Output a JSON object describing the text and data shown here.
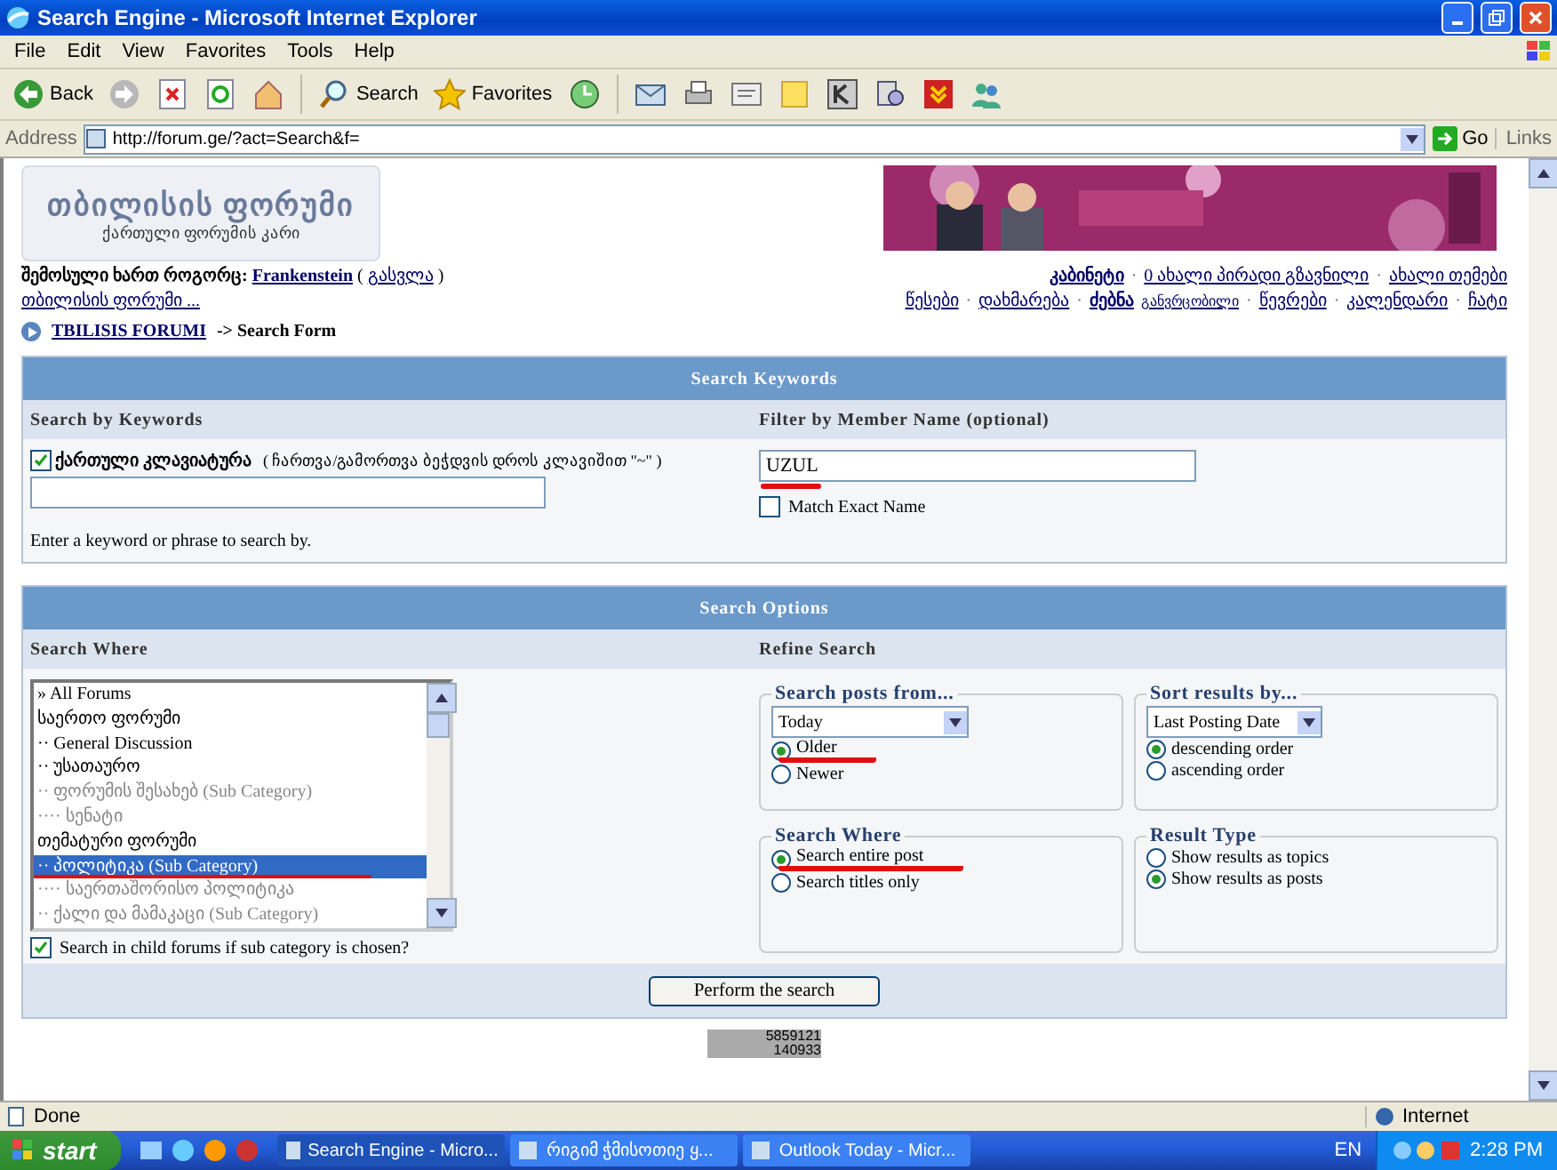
{
  "window": {
    "title": "Search Engine - Microsoft Internet Explorer"
  },
  "menu": [
    "File",
    "Edit",
    "View",
    "Favorites",
    "Tools",
    "Help"
  ],
  "toolbar": [
    {
      "kind": "back",
      "label": "Back"
    },
    {
      "kind": "forward"
    },
    {
      "kind": "stop"
    },
    {
      "kind": "refresh"
    },
    {
      "kind": "home"
    },
    {
      "kind": "search",
      "label": "Search"
    },
    {
      "kind": "favorites",
      "label": "Favorites"
    },
    {
      "kind": "history"
    },
    {
      "kind": "mail"
    },
    {
      "kind": "print"
    },
    {
      "kind": "edit"
    },
    {
      "kind": "note"
    },
    {
      "kind": "k"
    },
    {
      "kind": "research"
    },
    {
      "kind": "download"
    },
    {
      "kind": "people"
    }
  ],
  "address": {
    "label": "Address",
    "value": "http://forum.ge/?act=Search&f=",
    "go": "Go",
    "links": "Links"
  },
  "header": {
    "logo_title": "თბილისის ფორუმი",
    "logo_subtitle": "ქართული ფორუმის კარი"
  },
  "user_bar": {
    "prefix": "შემოსული ხართ როგორც:",
    "username": "Frankenstein",
    "open": "(",
    "logout": "გასვლა",
    "close": ")",
    "separator": "·",
    "forum_link": "თბილისის ფორუმი ...",
    "links_row1": [
      {
        "label": "კაბინეტი",
        "bold": true
      },
      {
        "label": "0 ახალი პირადი გზავნილი",
        "bold": false
      },
      {
        "label": "ახალი თემები",
        "bold": false
      }
    ],
    "links_row2": [
      {
        "label": "წესები",
        "bold": false
      },
      {
        "label": "დახმარება",
        "bold": false
      },
      {
        "label": "ძებნა",
        "bold": true,
        "sup": "განვრცობილი"
      },
      {
        "label": "წევრები",
        "bold": false
      },
      {
        "label": "კალენდარი",
        "bold": false
      },
      {
        "label": "ჩატი",
        "bold": false
      }
    ]
  },
  "breadcrumb": {
    "forum": "TBILISIS FORUMI",
    "page": "-> Search Form"
  },
  "keywords_panel": {
    "title": "Search Keywords",
    "left_heading": "Search by Keywords",
    "right_heading": "Filter by Member Name (optional)",
    "keyboard": {
      "label": "ქართული კლავიატურა",
      "hint": "( ჩართვა/გამორთვა ბეჭდვის დროს კლავიშით \"~\" )",
      "checked": true
    },
    "help": "Enter a keyword or phrase to search by.",
    "member_field": {
      "value": "UZUL",
      "underlined": true
    },
    "exact": {
      "label": "Match Exact Name",
      "checked": false
    }
  },
  "options_panel": {
    "title": "Search Options",
    "left_heading": "Search Where",
    "right_heading": "Refine Search",
    "forums": [
      {
        "label": "» All Forums",
        "selected": false,
        "disabled": false,
        "underlined": false
      },
      {
        "label": "საერთო ფორუმი",
        "selected": false,
        "disabled": false,
        "underlined": false
      },
      {
        "label": "·· General Discussion",
        "selected": false,
        "disabled": false,
        "underlined": false
      },
      {
        "label": "·· უსათაურო",
        "selected": false,
        "disabled": false,
        "underlined": false
      },
      {
        "label": "·· ფორუმის შესახებ (Sub Category)",
        "selected": false,
        "disabled": true,
        "underlined": false
      },
      {
        "label": "···· სენატი",
        "selected": false,
        "disabled": true,
        "underlined": false
      },
      {
        "label": "თემატური ფორუმი",
        "selected": false,
        "disabled": false,
        "underlined": false
      },
      {
        "label": "·· პოლიტიკა (Sub Category)",
        "selected": true,
        "disabled": false,
        "underlined": true
      },
      {
        "label": "···· საერთაშორისო პოლიტიკა",
        "selected": false,
        "disabled": true,
        "underlined": false
      },
      {
        "label": "·· ქალი და მამაკაცი (Sub Category)",
        "selected": false,
        "disabled": true,
        "underlined": false
      }
    ],
    "child": {
      "label": "Search in child forums if sub category is chosen?",
      "checked": true
    },
    "groups": [
      {
        "title": "Search posts from...",
        "select": "Today",
        "options": [
          {
            "label": "Older",
            "selected": true,
            "underlined": true
          },
          {
            "label": "Newer",
            "selected": false,
            "underlined": false
          }
        ]
      },
      {
        "title": "Sort results by...",
        "select": "Last Posting Date",
        "options": [
          {
            "label": "descending order",
            "selected": true,
            "underlined": false
          },
          {
            "label": "ascending order",
            "selected": false,
            "underlined": false
          }
        ]
      },
      {
        "title": "Search Where",
        "options": [
          {
            "label": "Search entire post",
            "selected": true,
            "underlined": true
          },
          {
            "label": "Search titles only",
            "selected": false,
            "underlined": false
          }
        ]
      },
      {
        "title": "Result Type",
        "options": [
          {
            "label": "Show results as topics",
            "selected": false,
            "underlined": false
          },
          {
            "label": "Show results as posts",
            "selected": true,
            "underlined": false
          }
        ]
      }
    ],
    "submit": "Perform the search"
  },
  "counter": [
    "5859121",
    "140933"
  ],
  "status": {
    "text": "Done",
    "zone": "Internet"
  },
  "taskbar": {
    "start": "start",
    "tasks": [
      {
        "label": "Search Engine - Micro...",
        "selected": true
      },
      {
        "label": "რიგიმ ჭმისოთიე ყ...",
        "selected": false
      },
      {
        "label": "Outlook Today - Micr...",
        "selected": false
      }
    ],
    "lang": "EN",
    "time": "2:28 PM"
  }
}
